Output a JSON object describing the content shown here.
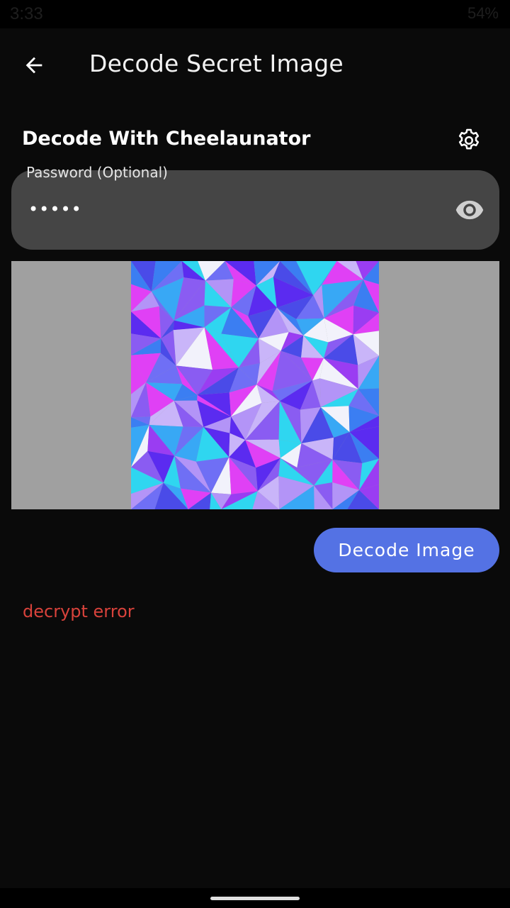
{
  "status_bar": {
    "time": "3:33",
    "battery": "54%"
  },
  "app_bar": {
    "back_icon": "arrow-left-icon",
    "title": "Decode Secret Image"
  },
  "section": {
    "title": "Decode With Cheelaunator",
    "settings_icon": "gear-icon"
  },
  "password": {
    "label": "Password (Optional)",
    "value": "•••••",
    "visibility_icon": "eye-icon"
  },
  "image_preview": {
    "frame_color": "#a0a0a0",
    "palette": [
      "#5b2bf0",
      "#8a5cf2",
      "#3b7ef2",
      "#2fd6f0",
      "#e040f5",
      "#b394f7",
      "#6f6ff5",
      "#c9b5f9",
      "#4a4be8",
      "#9a3df2",
      "#38a8f5",
      "#f2f2fb"
    ]
  },
  "decode_button": {
    "label": "Decode Image",
    "color": "#5472e4"
  },
  "result": {
    "message": "decrypt error",
    "color": "#d8423b"
  }
}
